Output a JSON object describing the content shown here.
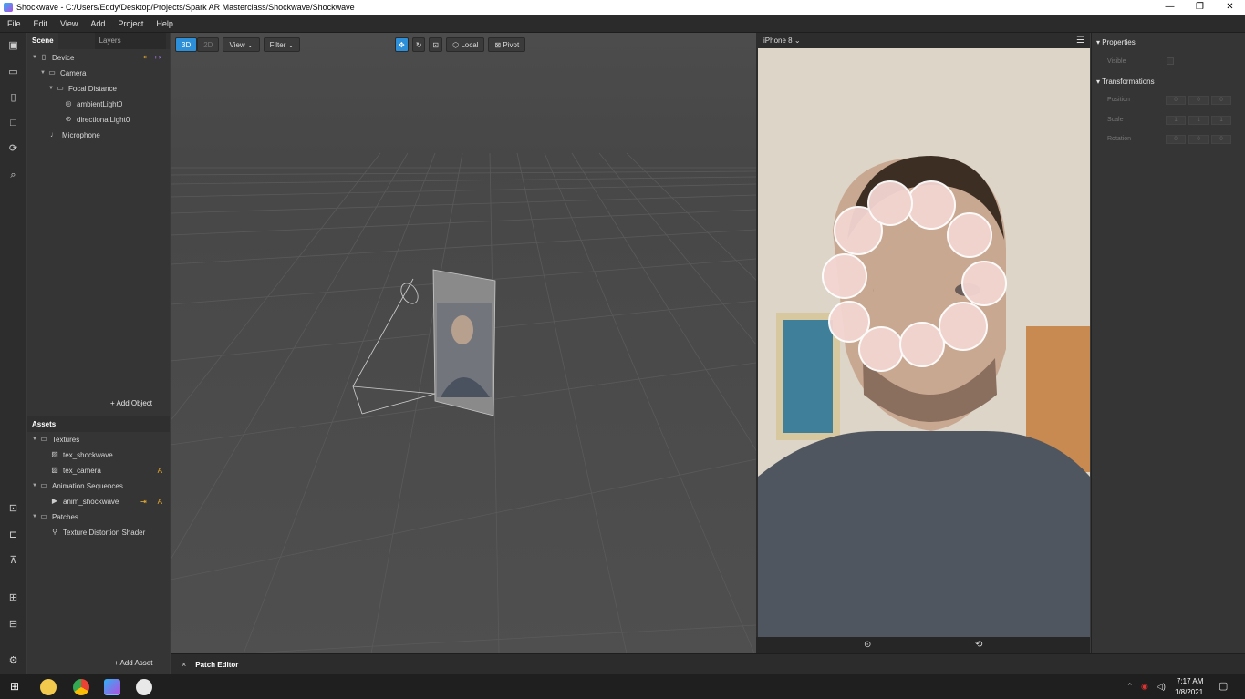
{
  "window": {
    "title": "Shockwave - C:/Users/Eddy/Desktop/Projects/Spark AR Masterclass/Shockwave/Shockwave",
    "minimize": "—",
    "maximize": "❐",
    "close": "✕"
  },
  "menu": [
    "File",
    "Edit",
    "View",
    "Add",
    "Project",
    "Help"
  ],
  "scene": {
    "tab_scene": "Scene",
    "tab_layers": "Layers",
    "tree": [
      {
        "label": "Device",
        "icon": "device-icon"
      },
      {
        "label": "Camera",
        "icon": "camera-icon"
      },
      {
        "label": "Focal Distance",
        "icon": "focal-distance-icon"
      },
      {
        "label": "ambientLight0",
        "icon": "ambient-light-icon"
      },
      {
        "label": "directionalLight0",
        "icon": "directional-light-icon"
      },
      {
        "label": "Microphone",
        "icon": "microphone-icon"
      }
    ],
    "add_object": "+ Add Object"
  },
  "assets": {
    "title": "Assets",
    "tree": [
      {
        "label": "Textures"
      },
      {
        "label": "tex_shockwave"
      },
      {
        "label": "tex_camera",
        "badge": "A"
      },
      {
        "label": "Animation Sequences"
      },
      {
        "label": "anim_shockwave",
        "badge": "A"
      },
      {
        "label": "Patches"
      },
      {
        "label": "Texture Distortion Shader"
      }
    ],
    "add_asset": "+ Add Asset"
  },
  "viewport": {
    "btn_3d": "3D",
    "btn_2d": "2D",
    "view": "View",
    "filter": "Filter",
    "local": "Local",
    "pivot": "Pivot"
  },
  "simulator": {
    "device": "iPhone 8"
  },
  "properties": {
    "title": "Properties",
    "visible": "Visible",
    "transformations": "Transformations",
    "position": "Position",
    "scale": "Scale",
    "rotation": "Rotation",
    "pos_fields": [
      "0",
      "0",
      "0"
    ],
    "scale_fields": [
      "1",
      "1",
      "1"
    ],
    "rot_fields": [
      "0",
      "0",
      "0"
    ]
  },
  "bottom": {
    "close": "×",
    "patch_editor": "Patch Editor"
  },
  "taskbar": {
    "time": "7:17 AM",
    "date": "1/8/2021"
  },
  "colors": {
    "accent": "#2d8fd8",
    "badge": "#f0b030",
    "link": "#b080ff"
  }
}
